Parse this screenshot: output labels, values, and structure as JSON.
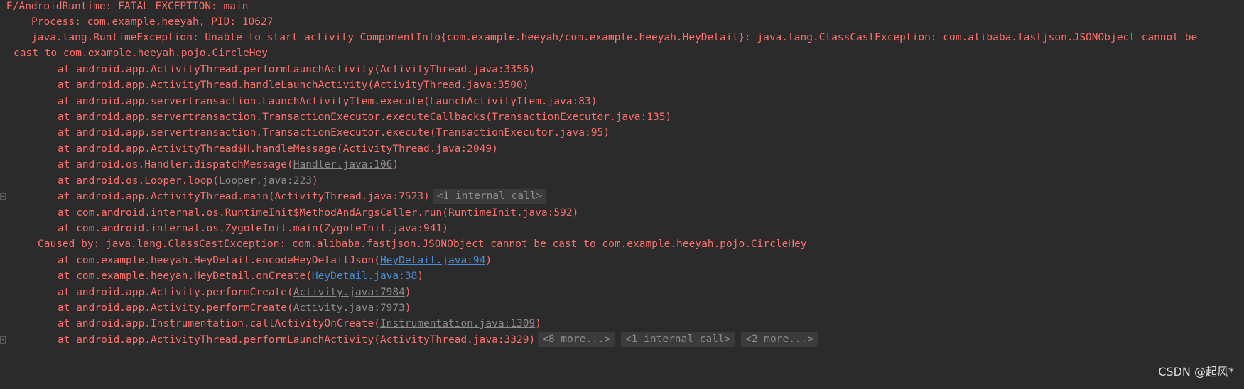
{
  "log": {
    "tag_line": "E/AndroidRuntime: FATAL EXCEPTION: main",
    "process_line": "Process: com.example.heeyah, PID: 10627",
    "exception_line_1": "java.lang.RuntimeException: Unable to start activity ComponentInfo{com.example.heeyah/com.example.heeyah.HeyDetail}: java.lang.ClassCastException: com.alibaba.fastjson.JSONObject cannot be",
    "exception_line_2": "cast to com.example.heeyah.pojo.CircleHey",
    "frames1": [
      {
        "text": "at android.app.ActivityThread.performLaunchActivity(ActivityThread.java:3356)"
      },
      {
        "text": "at android.app.ActivityThread.handleLaunchActivity(ActivityThread.java:3500)"
      },
      {
        "text": "at android.app.servertransaction.LaunchActivityItem.execute(LaunchActivityItem.java:83)"
      },
      {
        "text": "at android.app.servertransaction.TransactionExecutor.executeCallbacks(TransactionExecutor.java:135)"
      },
      {
        "text": "at android.app.servertransaction.TransactionExecutor.execute(TransactionExecutor.java:95)"
      },
      {
        "text": "at android.app.ActivityThread$H.handleMessage(ActivityThread.java:2049)"
      },
      {
        "pre": "at android.os.Handler.dispatchMessage(",
        "link": "Handler.java:106",
        "post": ")"
      },
      {
        "pre": "at android.os.Looper.loop(",
        "link": "Looper.java:223",
        "post": ")"
      },
      {
        "text": "at android.app.ActivityThread.main(ActivityThread.java:7523)",
        "fold": "<1 internal call>"
      },
      {
        "text": "at com.android.internal.os.RuntimeInit$MethodAndArgsCaller.run(RuntimeInit.java:592)"
      },
      {
        "text": "at com.android.internal.os.ZygoteInit.main(ZygoteInit.java:941)"
      }
    ],
    "caused_by": "Caused by: java.lang.ClassCastException: com.alibaba.fastjson.JSONObject cannot be cast to com.example.heeyah.pojo.CircleHey",
    "frames2": [
      {
        "pre": "at com.example.heeyah.HeyDetail.encodeHeyDetailJson(",
        "link": "HeyDetail.java:94",
        "post": ")",
        "link_style": "blue"
      },
      {
        "pre": "at com.example.heeyah.HeyDetail.onCreate(",
        "link": "HeyDetail.java:38",
        "post": ")",
        "link_style": "blue"
      },
      {
        "pre": "at android.app.Activity.performCreate(",
        "link": "Activity.java:7984",
        "post": ")"
      },
      {
        "pre": "at android.app.Activity.performCreate(",
        "link": "Activity.java:7973",
        "post": ")"
      },
      {
        "pre": "at android.app.Instrumentation.callActivityOnCreate(",
        "link": "Instrumentation.java:1309",
        "post": ")"
      },
      {
        "text": "at android.app.ActivityThread.performLaunchActivity(ActivityThread.java:3329)",
        "folds": [
          "<8 more...>",
          "<1 internal call>",
          "<2 more...>"
        ]
      }
    ]
  },
  "watermark": "CSDN @起风*",
  "colors": {
    "background": "#2b2b2b",
    "error_text": "#fd6f6b",
    "project_link": "#4a8cd6",
    "library_link": "#8b8b8b",
    "fold_bg": "#3b3b3b"
  },
  "icons": {
    "gutter_fold": "fold-toggle-icon"
  }
}
